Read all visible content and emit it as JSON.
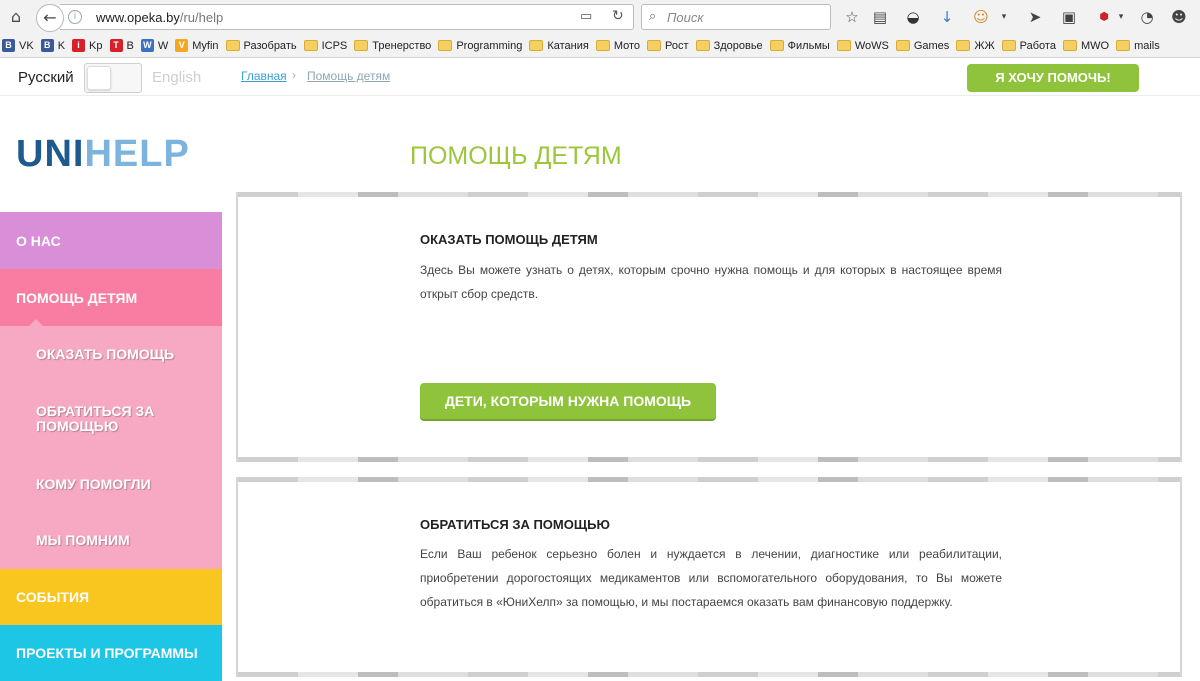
{
  "browser": {
    "url_domain": "www.opeka.by",
    "url_path": "/ru/help",
    "search_placeholder": "Поиск",
    "bookmarks": [
      {
        "label": "VK",
        "icon": "vk-icon",
        "color": "#3b5998",
        "glyph": "B"
      },
      {
        "label": "K",
        "icon": "vk-icon",
        "color": "#3b5998",
        "glyph": "B"
      },
      {
        "label": "Kp",
        "icon": "kp-icon",
        "color": "#d8202a",
        "glyph": "i"
      },
      {
        "label": "B",
        "icon": "b-icon",
        "color": "#d8202a",
        "glyph": "T"
      },
      {
        "label": "W",
        "icon": "w-icon",
        "color": "#3a72c0",
        "glyph": "W"
      },
      {
        "label": "Myfin",
        "icon": "myfin-icon",
        "color": "#f5a623",
        "glyph": "V"
      },
      {
        "label": "Разобрать",
        "icon": "folder-icon"
      },
      {
        "label": "ICPS",
        "icon": "folder-icon"
      },
      {
        "label": "Тренерство",
        "icon": "folder-icon"
      },
      {
        "label": "Programming",
        "icon": "folder-icon"
      },
      {
        "label": "Катания",
        "icon": "folder-icon"
      },
      {
        "label": "Мото",
        "icon": "folder-icon"
      },
      {
        "label": "Рост",
        "icon": "folder-icon"
      },
      {
        "label": "Здоровье",
        "icon": "folder-icon"
      },
      {
        "label": "Фильмы",
        "icon": "folder-icon"
      },
      {
        "label": "WoWS",
        "icon": "folder-icon"
      },
      {
        "label": "Games",
        "icon": "folder-icon"
      },
      {
        "label": "ЖЖ",
        "icon": "folder-icon"
      },
      {
        "label": "Работа",
        "icon": "folder-icon"
      },
      {
        "label": "MWO",
        "icon": "folder-icon"
      },
      {
        "label": "mails",
        "icon": "folder-icon"
      }
    ]
  },
  "header": {
    "lang_ru": "Русский",
    "lang_en": "English",
    "breadcrumb_home": "Главная",
    "breadcrumb_sep": "›",
    "breadcrumb_current": "Помощь детям",
    "help_button": "Я ХОЧУ ПОМОЧЬ!"
  },
  "logo": {
    "part1": "UNI",
    "part2": "HELP"
  },
  "page": {
    "title": "ПОМОЩЬ ДЕТЯМ"
  },
  "sidebar": {
    "items": [
      {
        "label": "О НАС",
        "color": "#d98fd8",
        "sub": false
      },
      {
        "label": "ПОМОЩЬ ДЕТЯМ",
        "color": "#f97da2",
        "sub": false
      },
      {
        "label": "ОКАЗАТЬ ПОМОЩЬ",
        "color": "#f7a9c4",
        "sub": true
      },
      {
        "label": "ОБРАТИТЬСЯ ЗА ПОМОЩЬЮ",
        "color": "#f7a9c4",
        "sub": true
      },
      {
        "label": "КОМУ ПОМОГЛИ",
        "color": "#f7a9c4",
        "sub": true
      },
      {
        "label": "МЫ ПОМНИМ",
        "color": "#f7a9c4",
        "sub": true
      },
      {
        "label": "СОБЫТИЯ",
        "color": "#f8c61e",
        "sub": false
      },
      {
        "label": "ПРОЕКТЫ И ПРОГРАММЫ",
        "color": "#1cc6e4",
        "sub": false
      }
    ]
  },
  "cards": [
    {
      "title": "ОКАЗАТЬ ПОМОЩЬ ДЕТЯМ",
      "text": "Здесь Вы можете узнать о  детях, которым срочно нужна помощь и для которых в настоящее время открыт сбор средств.",
      "button": "ДЕТИ, КОТОРЫМ НУЖНА ПОМОЩЬ"
    },
    {
      "title": "ОБРАТИТЬСЯ ЗА ПОМОЩЬЮ",
      "text": "Если Ваш ребенок серьезно болен и нуждается в лечении, диагностике или реабилитации, приобретении дорогостоящих медикаментов или вспомогательного оборудования, то Вы можете обратиться в «ЮниХелп» за помощью, и мы постараемся оказать вам финансовую поддержку."
    }
  ],
  "colors": {
    "accent": "#8fc33b",
    "link": "#3a9fd5",
    "logo_dark": "#1e5a8e",
    "logo_light": "#7cb4dd"
  }
}
